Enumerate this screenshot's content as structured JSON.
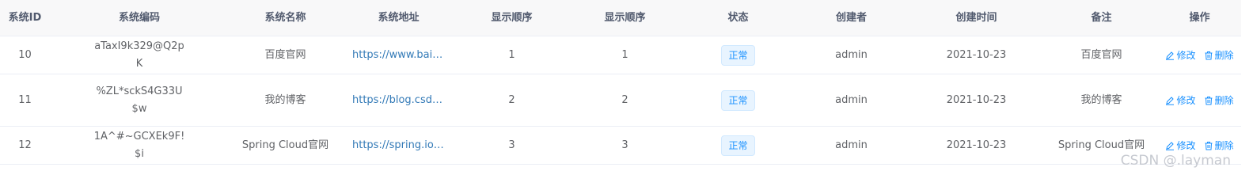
{
  "table": {
    "headers": [
      "系统ID",
      "系统编码",
      "系统名称",
      "系统地址",
      "显示顺序",
      "显示顺序",
      "状态",
      "创建者",
      "创建时间",
      "备注",
      "操作"
    ],
    "rows": [
      {
        "id": "10",
        "code": "aTaxI9k329@Q2pK",
        "name": "百度官网",
        "url": "https://www.baid…",
        "order1": "1",
        "order2": "1",
        "status": "正常",
        "creator": "admin",
        "created": "2021-10-23",
        "remark": "百度官网"
      },
      {
        "id": "11",
        "code": "%ZL*sckS4G33U$w",
        "name": "我的博客",
        "url": "https://blog.csdn.…",
        "order1": "2",
        "order2": "2",
        "status": "正常",
        "creator": "admin",
        "created": "2021-10-23",
        "remark": "我的博客"
      },
      {
        "id": "12",
        "code": "1A^#~GCXEk9F!$i",
        "name": "Spring Cloud官网",
        "url": "https://spring.io/p…",
        "order1": "3",
        "order2": "3",
        "status": "正常",
        "creator": "admin",
        "created": "2021-10-23",
        "remark": "Spring Cloud官网"
      }
    ],
    "actions": {
      "edit": "修改",
      "delete": "删除"
    }
  },
  "watermark": "CSDN @.layman",
  "colors": {
    "accent": "#1890ff",
    "link": "#337ab7",
    "header_bg": "#f8f8f9",
    "border": "#ebeef5"
  }
}
